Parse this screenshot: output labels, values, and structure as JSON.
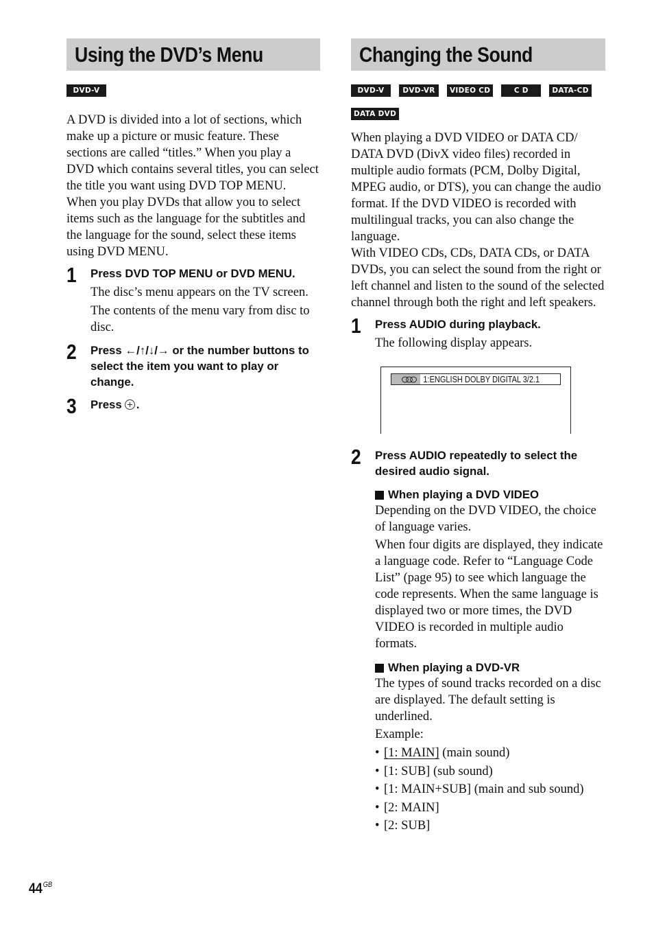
{
  "left": {
    "title": "Using the DVD’s Menu",
    "badges": [
      "DVD-V"
    ],
    "paragraphs": [
      "A DVD is divided into a lot of sections, which make up a picture or music feature. These sections are called “titles.” When you play a DVD which contains several titles, you can select the title you want using DVD TOP MENU.",
      "When you play DVDs that allow you to select items such as the language for the subtitles and the language for the sound, select these items using DVD MENU."
    ],
    "steps": [
      {
        "num": "1",
        "head": "Press DVD TOP MENU or DVD MENU.",
        "body": [
          "The disc’s menu appears on the TV screen.",
          "The contents of the menu vary from disc to disc."
        ]
      },
      {
        "num": "2",
        "head": "Press ←/↑/↓/→ or the number buttons to select the item you want to play or change."
      },
      {
        "num": "3",
        "head_prefix": "Press",
        "head_icon": "enter-button-icon",
        "head_suffix": "."
      }
    ]
  },
  "right": {
    "title": "Changing the Sound",
    "badges": [
      "DVD-V",
      "DVD-VR",
      "VIDEO CD",
      "C D",
      "DATA-CD",
      "DATA DVD"
    ],
    "paragraphs": [
      "When playing a DVD VIDEO or DATA CD/ DATA DVD (DivX video files) recorded in multiple audio formats (PCM, Dolby Digital, MPEG audio, or DTS), you can change the audio format. If the DVD VIDEO is recorded with multilingual tracks, you can also change the language.",
      "With VIDEO CDs, CDs, DATA CDs, or DATA DVDs, you can select the sound from the right or left channel and listen to the sound of the selected channel through both the right and left speakers."
    ],
    "step1": {
      "num": "1",
      "head": "Press AUDIO during playback.",
      "body": "The following display appears."
    },
    "osd": {
      "icon": "audio-disc-icon",
      "text": "1:ENGLISH  DOLBY DIGITAL 3/2.1"
    },
    "step2": {
      "num": "2",
      "head": "Press AUDIO repeatedly to select the desired audio signal.",
      "dvd_video": {
        "heading": "When playing a DVD VIDEO",
        "paragraphs": [
          "Depending on the DVD VIDEO, the choice of language varies.",
          "When four digits are displayed, they indicate a language code. Refer to “Language Code List” (page 95) to see which language the code represents. When the same language is displayed two or more times, the DVD VIDEO is recorded in multiple audio formats."
        ]
      },
      "dvd_vr": {
        "heading": "When playing a DVD-VR",
        "paragraph": "The types of sound tracks recorded on a disc are displayed. The default setting is underlined.",
        "example_label": "Example:",
        "items": [
          {
            "option": "[1: MAIN]",
            "note": " (main sound)",
            "default": true
          },
          {
            "option": "[1: SUB]",
            "note": " (sub sound)",
            "default": false
          },
          {
            "option": "[1: MAIN+SUB]",
            "note": " (main and sub sound)",
            "default": false
          },
          {
            "option": "[2: MAIN]",
            "note": "",
            "default": false
          },
          {
            "option": "[2: SUB]",
            "note": "",
            "default": false
          }
        ]
      }
    }
  },
  "footer": {
    "page_number": "44",
    "page_suffix": "GB"
  }
}
